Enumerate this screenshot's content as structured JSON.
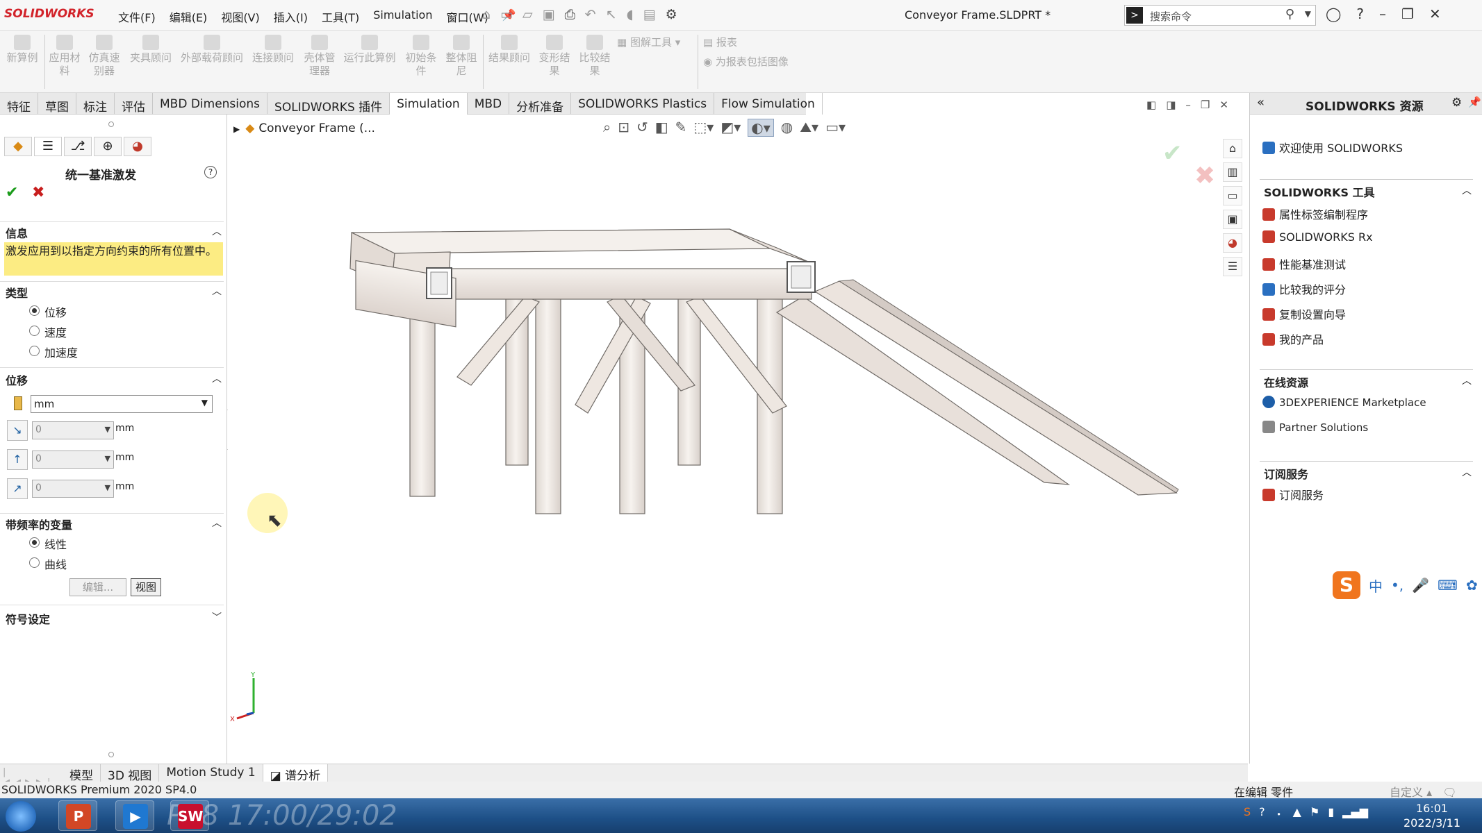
{
  "titlebar": {
    "logo": "SOLIDWORKS",
    "menus": [
      "文件(F)",
      "编辑(E)",
      "视图(V)",
      "插入(I)",
      "工具(T)",
      "Simulation",
      "窗口(W)"
    ],
    "doc_title": "Conveyor Frame.SLDPRT *",
    "search_placeholder": "搜索命令",
    "icons": [
      "home-icon",
      "new-icon",
      "open-icon",
      "save-icon",
      "print-icon",
      "undo-icon",
      "select-icon",
      "rebuild-icon",
      "file-props-icon",
      "options-icon"
    ]
  },
  "ribbon": {
    "buttons": [
      {
        "label1": "新算例",
        "label2": ""
      },
      {
        "label1": "应用材",
        "label2": "料"
      },
      {
        "label1": "仿真速",
        "label2": "别器"
      },
      {
        "label1": "夹具顾问",
        "label2": ""
      },
      {
        "label1": "外部载荷顾问",
        "label2": ""
      },
      {
        "label1": "连接顾问",
        "label2": ""
      },
      {
        "label1": "壳体管",
        "label2": "理器"
      },
      {
        "label1": "运行此算例",
        "label2": ""
      },
      {
        "label1": "初始条",
        "label2": "件"
      },
      {
        "label1": "整体阻",
        "label2": "尼"
      },
      {
        "label1": "结果顾问",
        "label2": ""
      },
      {
        "label1": "变形结",
        "label2": "果"
      },
      {
        "label1": "比较结",
        "label2": "果"
      }
    ],
    "plot_tools": "图解工具",
    "report": "报表",
    "include_image": "为报表包括图像"
  },
  "cmd_tabs": [
    "特征",
    "草图",
    "标注",
    "评估",
    "MBD Dimensions",
    "SOLIDWORKS 插件",
    "Simulation",
    "MBD",
    "分析准备",
    "SOLIDWORKS Plastics",
    "Flow Simulation"
  ],
  "active_cmd_tab": "Simulation",
  "pm": {
    "title": "统一基准激发",
    "info_header": "信息",
    "info_text": "激发应用到以指定方向约束的所有位置中。",
    "type_header": "类型",
    "type_options": [
      "位移",
      "速度",
      "加速度"
    ],
    "disp_header": "位移",
    "unit": "mm",
    "rows": [
      {
        "value": "0",
        "unit": "mm"
      },
      {
        "value": "0",
        "unit": "mm"
      },
      {
        "value": "0",
        "unit": "mm"
      }
    ],
    "freq_header": "带频率的变量",
    "freq_options": [
      "线性",
      "曲线"
    ],
    "edit_btn": "编辑...",
    "view_btn": "视图",
    "symbol_header": "符号设定"
  },
  "viewport": {
    "tree_label": "Conveyor Frame (..."
  },
  "rpane": {
    "title": "SOLIDWORKS 资源",
    "welcome": "欢迎使用 SOLIDWORKS",
    "tools_header": "SOLIDWORKS 工具",
    "tools": [
      "属性标签编制程序",
      "SOLIDWORKS Rx",
      "性能基准测试",
      "比较我的评分",
      "复制设置向导",
      "我的产品"
    ],
    "online_header": "在线资源",
    "online": [
      "3DEXPERIENCE Marketplace",
      "Partner Solutions"
    ],
    "subs_header": "订阅服务",
    "subs": [
      "订阅服务"
    ]
  },
  "ime": {
    "brand": "S",
    "lang": "中"
  },
  "model_tabs": [
    "模型",
    "3D 视图",
    "Motion Study 1",
    "谱分析"
  ],
  "active_model_tab": "谱分析",
  "status": {
    "left": "SOLIDWORKS Premium 2020 SP4.0",
    "mid": "在编辑 零件",
    "right": "自定义"
  },
  "taskbar": {
    "watermark": "P48 17:00/29:02",
    "time": "16:01",
    "date": "2022/3/11"
  },
  "colors": {
    "accent": "#d2232a",
    "info_bg": "#fcec83",
    "ok": "#1a9b1a",
    "cancel": "#c81e1e"
  }
}
